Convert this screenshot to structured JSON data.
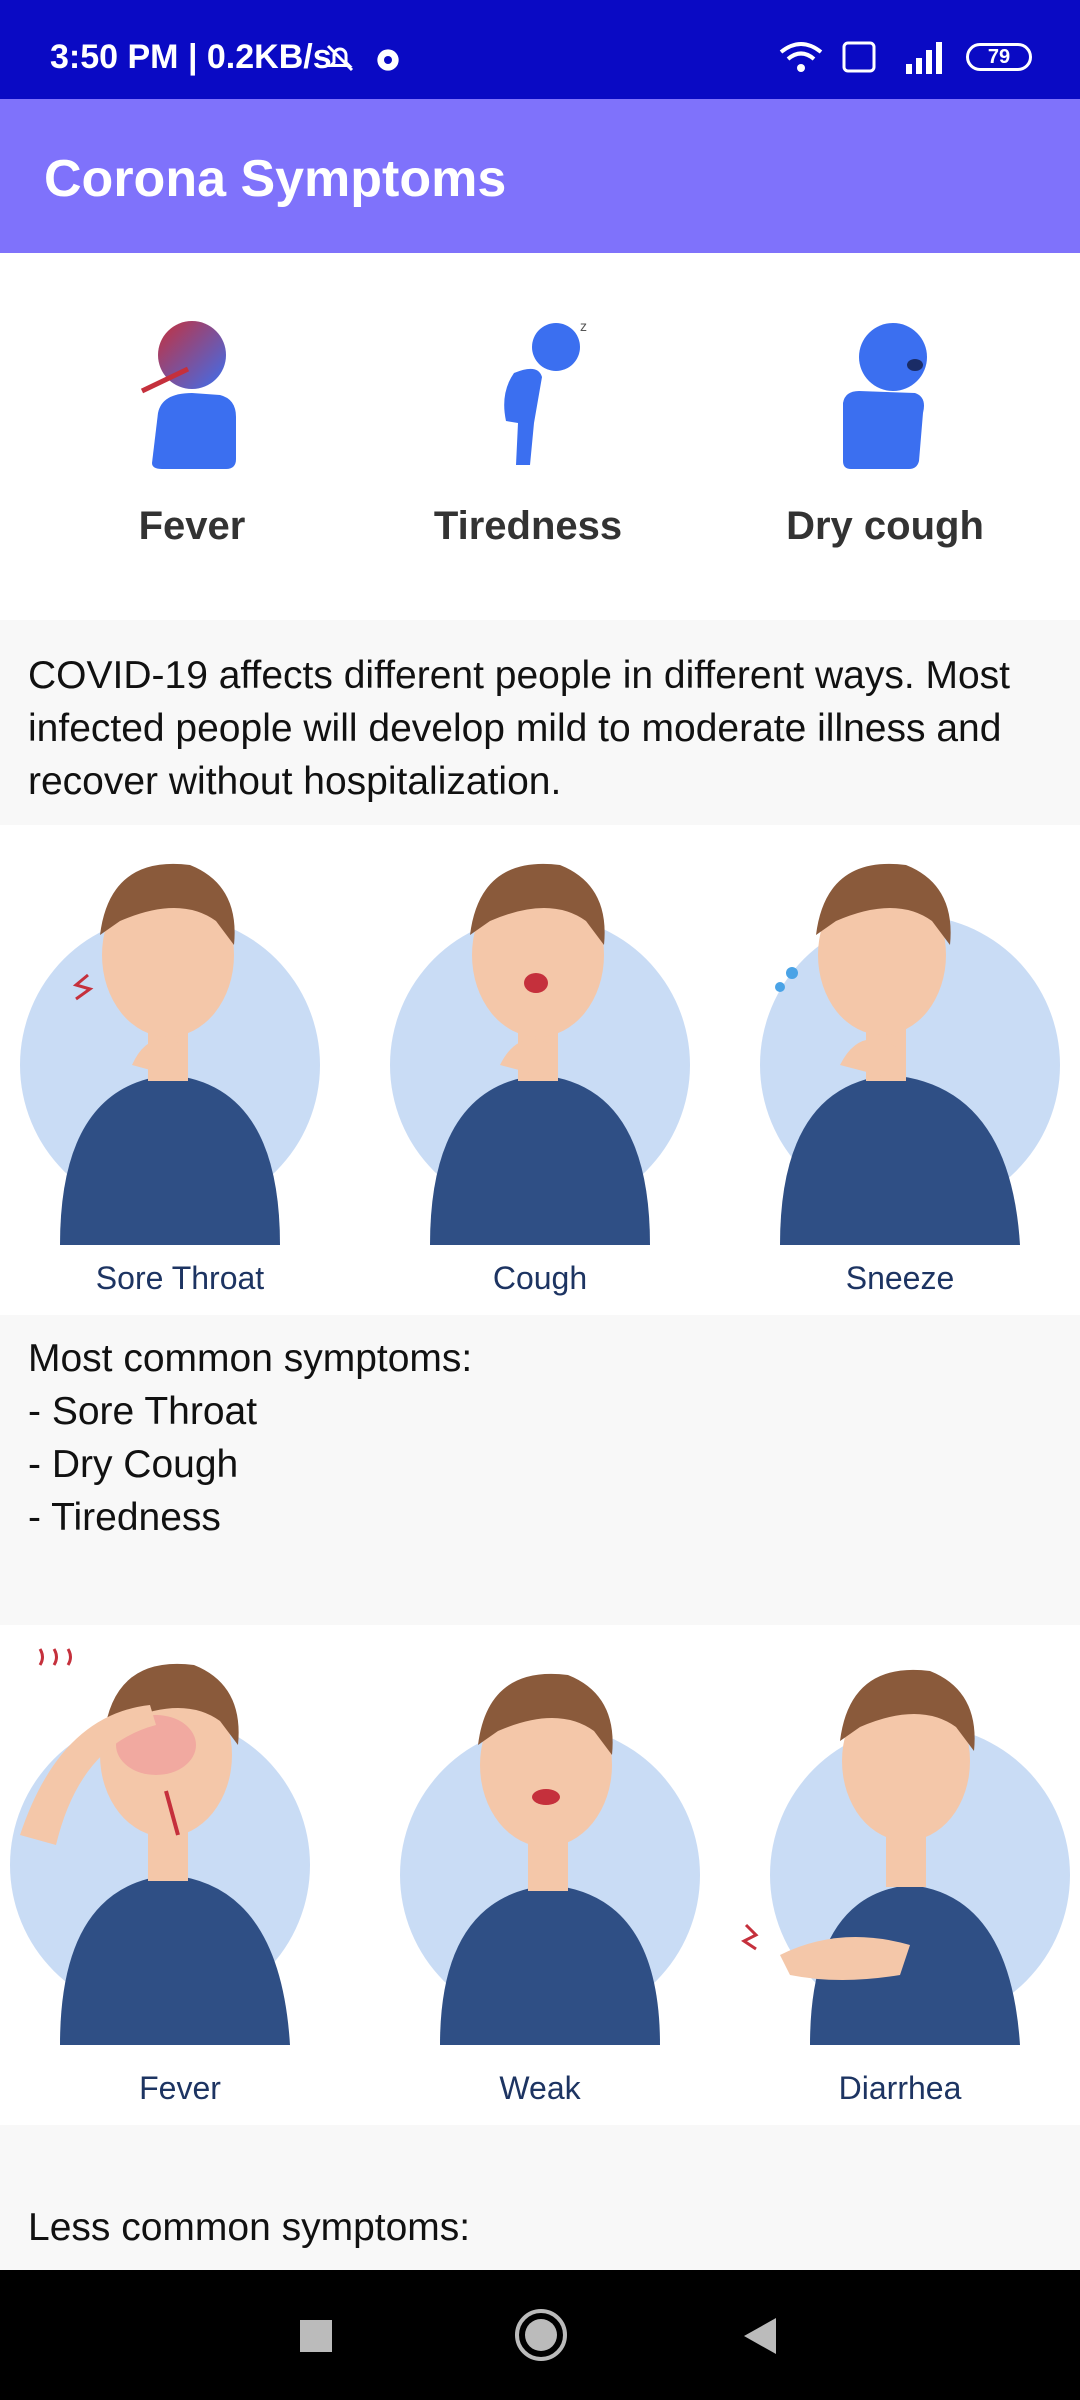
{
  "status": {
    "time": "3:50 PM | 0.2KB/s",
    "battery": "79"
  },
  "app": {
    "title": "Corona Symptoms"
  },
  "top_symptoms": [
    {
      "label": "Fever"
    },
    {
      "label": "Tiredness"
    },
    {
      "label": "Dry cough"
    }
  ],
  "intro": "COVID-19 affects different people in different ways. Most infected people will develop mild to moderate illness and recover without hospitalization.",
  "row1": [
    {
      "label": "Sore Throat"
    },
    {
      "label": "Cough"
    },
    {
      "label": "Sneeze"
    }
  ],
  "common": "Most common symptoms:\n- Sore Throat\n- Dry Cough\n- Tiredness",
  "row2": [
    {
      "label": "Fever"
    },
    {
      "label": "Weak"
    },
    {
      "label": "Diarrhea"
    }
  ],
  "less_common": "Less common symptoms:",
  "colors": {
    "status_bar": "#0a0ac4",
    "app_bar": "#7f72fb",
    "shirt": "#2f4f85",
    "circle": "#c9dcf5",
    "icon_blue": "#3b6ff0"
  }
}
